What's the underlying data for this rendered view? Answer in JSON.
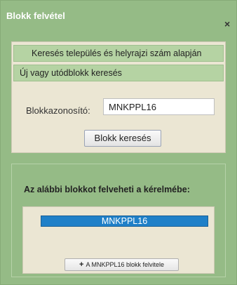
{
  "dialog": {
    "title": "Blokk felvétel",
    "close_label": "×"
  },
  "accordion": {
    "section1_label": "Keresés település és helyrajzi szám alapján",
    "section2_label": "Új vagy utódblokk keresés"
  },
  "search": {
    "block_id_label": "Blokkazonosító:",
    "block_id_value": "MNKPPL16",
    "search_button_label": "Blokk keresés"
  },
  "result": {
    "heading": "Az alábbi blokkot felveheti a kérelmébe:",
    "selected_block": "MNKPPL16",
    "add_button_label": "A MNKPPL16 blokk felvitele",
    "selected_color": "#1f80c8"
  },
  "icons": {
    "close": "close-icon",
    "add": "plus-icon"
  }
}
